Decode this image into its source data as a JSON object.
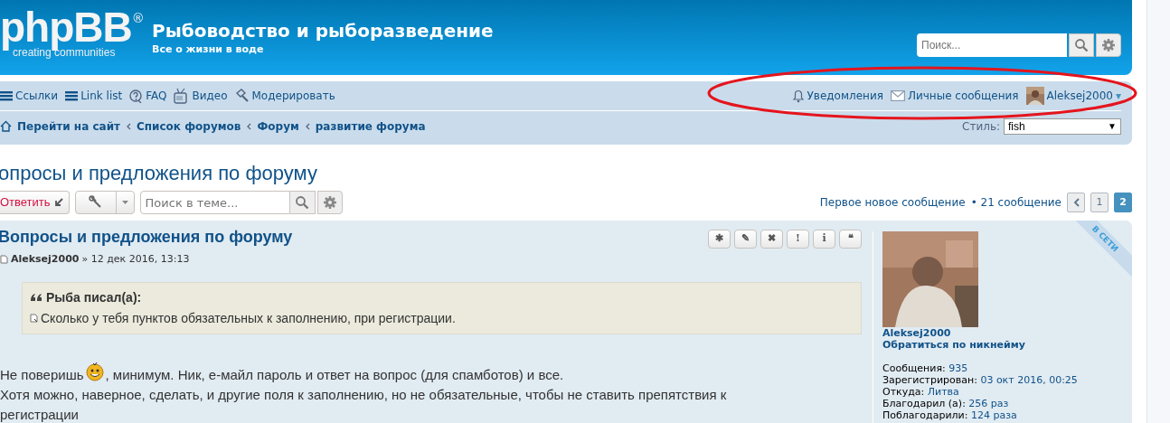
{
  "header": {
    "logo": "phpBB",
    "logo_mark": "®",
    "logo_tagline": "creating communities",
    "site_title": "Рыбоводство и рыборазведение",
    "site_description": "Все о жизни в воде",
    "search": {
      "placeholder": "Поиск..."
    }
  },
  "navbar": {
    "links": [
      {
        "kind": "menu",
        "label": "Ссылки"
      },
      {
        "kind": "menu",
        "label": "Link list"
      },
      {
        "kind": "faq",
        "label": "FAQ"
      },
      {
        "kind": "video",
        "label": "Видео"
      },
      {
        "kind": "moderate",
        "label": "Модерировать"
      }
    ],
    "user_links": [
      {
        "kind": "bell",
        "label": "Уведомления"
      },
      {
        "kind": "mail",
        "label": "Личные сообщения"
      }
    ],
    "user": {
      "name": "Aleksej2000",
      "caret": "▾"
    },
    "breadcrumbs": [
      "Перейти на сайт",
      "Список форумов",
      "Форум",
      "развитие форума"
    ],
    "style_select": {
      "label": "Стиль:",
      "value": "fish",
      "caret": "▼"
    }
  },
  "topic": {
    "title": "опросы и предложения по форуму",
    "reply_button": "Ответить",
    "search": {
      "placeholder": "Поиск в теме..."
    },
    "first_new": "Первое новое сообщение",
    "count": "• 21 сообщение",
    "pages": [
      {
        "label": "1",
        "selected": false
      },
      {
        "label": "2",
        "selected": true
      }
    ]
  },
  "post": {
    "title": "Вопросы и предложения по форуму",
    "author": "Aleksej2000",
    "date": "» 12 дек 2016, 13:13",
    "actions": [
      "✱",
      "✎",
      "✖",
      "!",
      "i",
      "❝"
    ],
    "quote": {
      "author": "Рыба",
      "suffix": "писал(а):",
      "text": "Сколько у тебя пунктов обязательных к заполнению, при регистрации."
    },
    "body": [
      {
        "before": "Не поверишь",
        "after": ", минимум. Ник, е-майл пароль и ответ на вопрос (для спамботов) и все."
      },
      {
        "before": "Хотя можно, наверное, сделать, и другие поля к заполнению, но не обязательные, чтобы не ставить препятствия к регистрации"
      }
    ],
    "online": "В СЕТИ",
    "profile": {
      "name": "Aleksej2000",
      "rank": "Обратиться по никнейму",
      "fields": [
        {
          "label": "Сообщения:",
          "value": "935"
        },
        {
          "label": "Зарегистрирован:",
          "value": "03 окт 2016, 00:25"
        },
        {
          "label": "Откуда:",
          "value": "Литва"
        },
        {
          "label": "Благодарил (а):",
          "value": "256 раз"
        },
        {
          "label": "Поблагодарили:",
          "value": "124 раза"
        }
      ]
    }
  },
  "annotation": {
    "kind": "ellipse"
  }
}
